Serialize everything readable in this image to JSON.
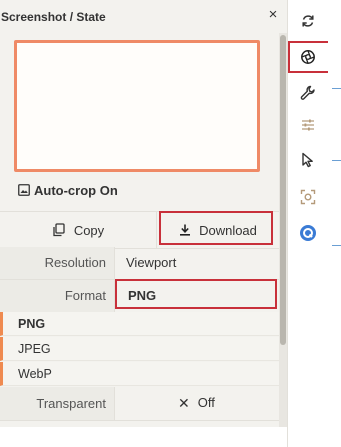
{
  "panel": {
    "title": "Screenshot / State",
    "close_glyph": "×",
    "autocrop_label": "Auto-crop On",
    "autocrop_icon": "image-icon"
  },
  "actions": {
    "copy_label": "Copy",
    "download_label": "Download"
  },
  "settings": {
    "resolution_label": "Resolution",
    "resolution_value": "Viewport",
    "format_label": "Format",
    "format_value": "PNG",
    "format_options": [
      "PNG",
      "JPEG",
      "WebP"
    ],
    "transparent_label": "Transparent",
    "transparent_glyph": "✕",
    "transparent_value": "Off"
  },
  "toolbar": {
    "items": [
      "refresh-icon",
      "aperture-icon",
      "wrench-icon",
      "sliders-icon",
      "cursor-icon",
      "capture-icon",
      "app-icon"
    ]
  },
  "colors": {
    "accent": "#ef8a66",
    "highlight": "#c8303a",
    "panel_bg": "#f3f2ee"
  }
}
